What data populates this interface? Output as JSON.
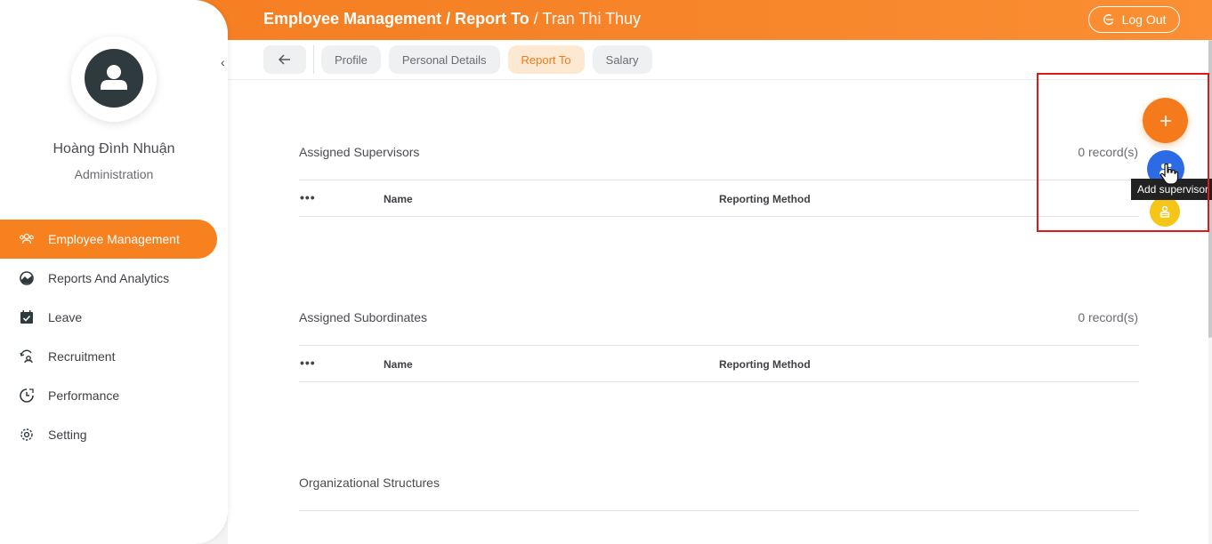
{
  "header": {
    "crumb_1": "Employee Management",
    "crumb_sep_1": " / ",
    "crumb_2": "Report To",
    "crumb_sep_2": " / ",
    "crumb_current": "Tran Thi Thuy",
    "logout_label": "Log Out"
  },
  "user": {
    "name": "Hoàng Đình Nhuận",
    "role": "Administration"
  },
  "sidebar": {
    "collapse_glyph": "‹",
    "items": [
      {
        "label": "Employee Management",
        "icon": "people-icon",
        "active": true
      },
      {
        "label": "Reports And Analytics",
        "icon": "chart-icon",
        "active": false
      },
      {
        "label": "Leave",
        "icon": "calendar-check-icon",
        "active": false
      },
      {
        "label": "Recruitment",
        "icon": "recruitment-icon",
        "active": false
      },
      {
        "label": "Performance",
        "icon": "performance-icon",
        "active": false
      },
      {
        "label": "Setting",
        "icon": "gear-icon",
        "active": false
      }
    ]
  },
  "tabs": {
    "items": [
      "Profile",
      "Personal Details",
      "Report To",
      "Salary"
    ],
    "active": "Report To"
  },
  "sections": {
    "supervisors": {
      "title": "Assigned Supervisors",
      "count": "0 record(s)",
      "col_more": "•••",
      "col_name": "Name",
      "col_method": "Reporting Method"
    },
    "subordinates": {
      "title": "Assigned Subordinates",
      "count": "0 record(s)",
      "col_more": "•••",
      "col_name": "Name",
      "col_method": "Reporting Method"
    },
    "org": {
      "title": "Organizational Structures"
    }
  },
  "fab": {
    "main_icon": "plus-icon",
    "supervisor_icon": "add-supervisor-icon",
    "subordinate_icon": "add-subordinate-icon",
    "tooltip": "Add supervisor"
  },
  "colors": {
    "accent": "#f7801f",
    "blue": "#2d6be4",
    "yellow": "#f5c518"
  }
}
